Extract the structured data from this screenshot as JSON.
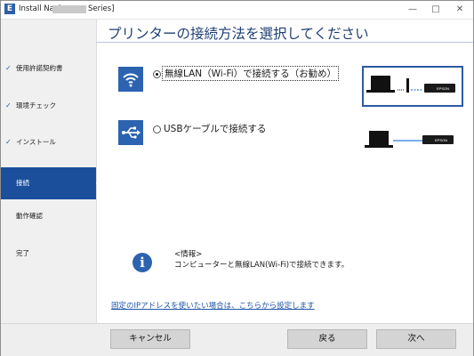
{
  "window": {
    "title_prefix": "Install Navi",
    "title_suffix": "Series]",
    "app_icon_glyph": "E",
    "minimize_glyph": "—",
    "maximize_glyph": "□",
    "close_glyph": "✕"
  },
  "sidebar": {
    "items": [
      {
        "label": "使用許諾契約書",
        "status": "done"
      },
      {
        "label": "環境チェック",
        "status": "done"
      },
      {
        "label": "インストール",
        "status": "done"
      },
      {
        "label": "接続",
        "status": "current"
      },
      {
        "label": "動作確認",
        "status": "pending"
      },
      {
        "label": "完了",
        "status": "pending"
      }
    ],
    "check_glyph": "✓"
  },
  "main": {
    "title": "プリンターの接続方法を選択してください",
    "options": [
      {
        "label": "無線LAN（Wi-Fi）で接続する（お勧め）",
        "selected": true,
        "icon": "wifi-icon"
      },
      {
        "label": "USBケーブルで接続する",
        "selected": false,
        "icon": "usb-icon"
      }
    ],
    "info": {
      "heading": "<情報>",
      "body": "コンピューターと無線LAN(Wi-Fi)で接続できます。"
    },
    "link": "固定のIPアドレスを使いたい場合は、こちらから設定します"
  },
  "footer": {
    "cancel": "キャンセル",
    "back": "戻る",
    "next": "次へ"
  },
  "colors": {
    "accent": "#1b4f9c",
    "icon_bg": "#2c63b0",
    "link": "#2255a8"
  }
}
